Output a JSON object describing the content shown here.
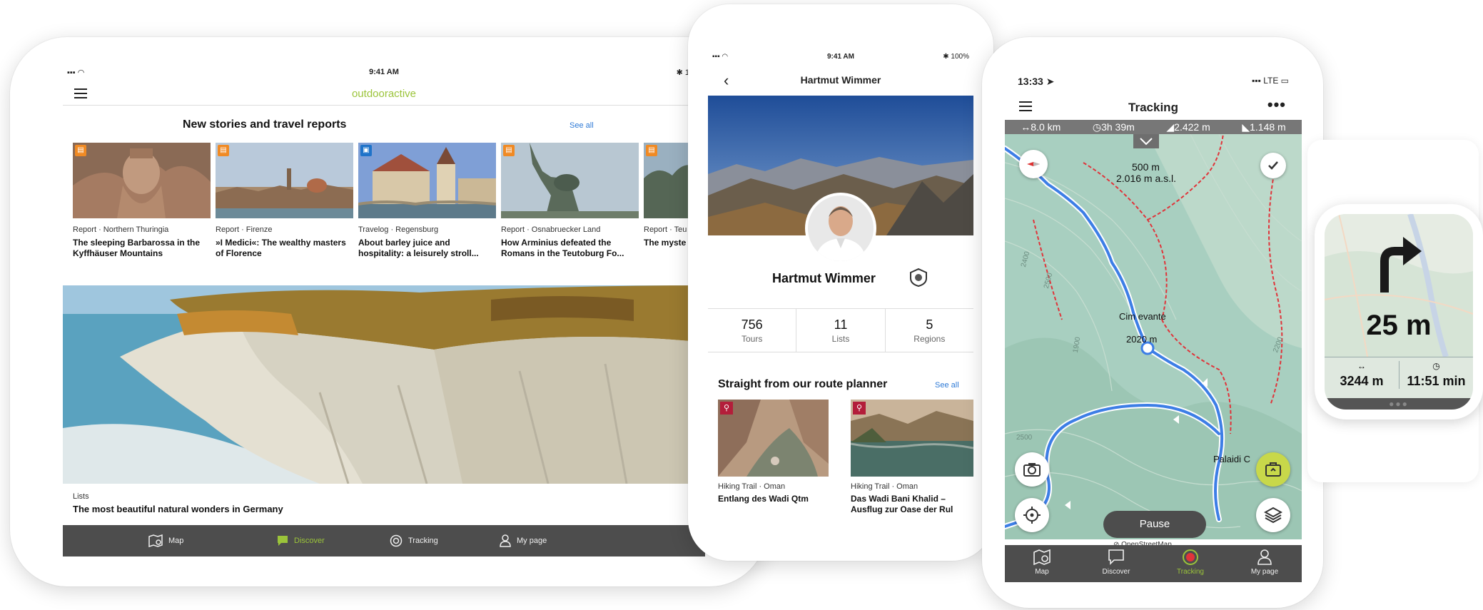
{
  "tablet": {
    "status": {
      "signal": "▪▪▪ ◠",
      "time": "9:41 AM",
      "battery": "✱ 100%"
    },
    "brand": "outdooractive",
    "section_title": "New stories and travel reports",
    "see_all": "See all",
    "cards": [
      {
        "category": "Report · Northern Thuringia",
        "title": "The sleeping Barbarossa in the Kyffhäuser Mountains"
      },
      {
        "category": "Report · Firenze",
        "title": "»I Medici«: The wealthy masters of Florence"
      },
      {
        "category": "Travelog · Regensburg",
        "title": "About barley juice and hospitality: a leisurely stroll..."
      },
      {
        "category": "Report · Osnabruecker Land",
        "title": "How Arminius defeated the Romans in the Teutoburg Fo..."
      },
      {
        "category": "Report · Teu",
        "title": "The myste"
      }
    ],
    "hero": {
      "category": "Lists",
      "title": "The most beautiful natural wonders in Germany"
    },
    "tabs": {
      "map": "Map",
      "discover": "Discover",
      "tracking": "Tracking",
      "mypage": "My page"
    },
    "colors": {
      "accent": "#9bc43a",
      "tabbar": "#4d4d4d",
      "link": "#2e7ad6",
      "story_badge": "#f08a24",
      "travelog_badge": "#1f73c9"
    }
  },
  "profile": {
    "status": {
      "signal": "▪▪▪ ◠",
      "time": "9:41 AM",
      "battery": "✱ 100%"
    },
    "header_name": "Hartmut Wimmer",
    "user_name": "Hartmut Wimmer",
    "stats": [
      {
        "value": "756",
        "label": "Tours"
      },
      {
        "value": "11",
        "label": "Lists"
      },
      {
        "value": "5",
        "label": "Regions"
      }
    ],
    "section_title": "Straight from our route planner",
    "see_all": "See all",
    "cards": [
      {
        "category": "Hiking Trail · Oman",
        "title": "Entlang des Wadi Qtm"
      },
      {
        "category": "Hiking Trail · Oman",
        "title": "Das Wadi Bani Khalid – Ausflug zur Oase der Rul"
      }
    ],
    "colors": {
      "hiking_badge": "#b31e3a"
    }
  },
  "tracking": {
    "status": {
      "time": "13:33 ➤",
      "signal": "▪▪▪ LTE ▭"
    },
    "title": "Tracking",
    "more": "•••",
    "stats": [
      {
        "icon": "↔",
        "value": "8.0 km"
      },
      {
        "icon": "◷",
        "value": "3h 39m"
      },
      {
        "icon": "◢",
        "value": "2.422 m"
      },
      {
        "icon": "◣",
        "value": "1.148 m"
      }
    ],
    "map_labels": {
      "dist_label": "500 m",
      "alt_label": "2.016 m a.s.l.",
      "peak_name": "Cim  evante",
      "peak_alt": "2020 m",
      "place": "Palaidi C",
      "contour_1": "2400",
      "contour_2": "2500",
      "contour_3": "1900",
      "contour_4": "2200",
      "contour_5": "2500"
    },
    "pause": "Pause",
    "osm": "⊘ OpenStreetMap",
    "tabs": {
      "map": "Map",
      "discover": "Discover",
      "tracking": "Tracking",
      "mypage": "My page"
    },
    "colors": {
      "route": "#3d7ee6",
      "trail": "#e0343a",
      "map_bg": "#a8cfc0",
      "pin_bg": "#c8d84a"
    }
  },
  "watch": {
    "distance": "25 m",
    "left_icon": "↔",
    "left_value": "3244 m",
    "right_icon": "◷",
    "right_value": "11:51 min",
    "dots": "●●●"
  }
}
